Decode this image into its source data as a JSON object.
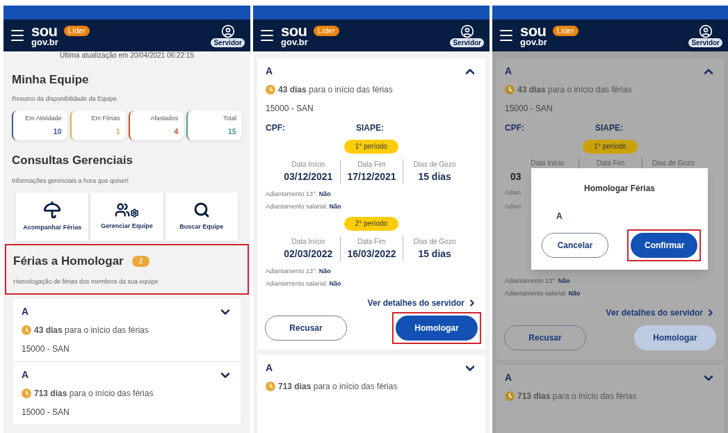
{
  "screens": [
    {
      "kind": "home",
      "header": {
        "logo_top": "sou",
        "logo_bottom": "gov.br",
        "role": "Líder",
        "profile": "Servidor"
      },
      "last_update": "Última atualização em 20/04/2021 06:22:15",
      "team": {
        "title": "Minha Equipe",
        "subtitle": "Resumo da disponibilidade da Equipe",
        "stats": [
          {
            "label": "Em Atividade",
            "value": "10",
            "color": "#3b5b9e"
          },
          {
            "label": "Em Férias",
            "value": "1",
            "color": "#e3b341"
          },
          {
            "label": "Afastados",
            "value": "4",
            "color": "#c4552b"
          },
          {
            "label": "Total",
            "value": "15",
            "color": "#4d9c8c"
          }
        ]
      },
      "queries": {
        "title": "Consultas Gerenciais",
        "subtitle": "Informações gerenciais a hora que quiser!",
        "shortcuts": [
          {
            "label": "Acompanhar Férias",
            "kind": "beach"
          },
          {
            "label": "Gerenciar Equipe",
            "kind": "team"
          },
          {
            "label": "Buscar Equipe",
            "kind": "search"
          }
        ]
      },
      "pending": {
        "title": "Férias a Homologar",
        "count": "2",
        "subtitle": "Homologação de férias dos membros da sua equipe",
        "highlighted": true
      },
      "requests": [
        {
          "name": "A",
          "expanded": false,
          "countdown": "**43 dias** para o início das férias",
          "unit": "15000 - SAN"
        },
        {
          "name": "A",
          "expanded": false,
          "countdown": "**713 dias** para o início das férias",
          "unit": "15000 - SAN"
        }
      ]
    },
    {
      "kind": "detail",
      "header": {
        "logo_top": "sou",
        "logo_bottom": "gov.br",
        "role": "Líder",
        "profile": "Servidor"
      },
      "request": {
        "name": "A",
        "expanded": true,
        "countdown": "**43 dias** para o início das férias",
        "unit": "15000 - SAN",
        "cpf_label": "CPF:",
        "siape_label": "SIAPE:",
        "periods": [
          {
            "label": "1° período",
            "fields": [
              {
                "label": "Data Início",
                "value": "03/12/2021"
              },
              {
                "label": "Data Fim",
                "value": "17/12/2021"
              },
              {
                "label": "Dias de Gozo",
                "value": "15 dias"
              }
            ],
            "advances": [
              "Adiantamento 13°: **Não**",
              "Adiantamento salarial: **Não**"
            ]
          },
          {
            "label": "2° período",
            "fields": [
              {
                "label": "Data Início",
                "value": "02/03/2022"
              },
              {
                "label": "Data Fim",
                "value": "16/03/2022"
              },
              {
                "label": "Dias de Gozo",
                "value": "15 dias"
              }
            ],
            "advances": [
              "Adiantamento 13°: **Não**",
              "Adiantamento salarial: **Não**"
            ]
          }
        ],
        "details_link": "Ver detalhes do servidor",
        "buttons": [
          {
            "label": "Recusar",
            "kind": "outline",
            "highlighted": false,
            "disabled": false
          },
          {
            "label": "Homologar",
            "kind": "primary",
            "highlighted": true,
            "disabled": false
          }
        ]
      },
      "next_request": {
        "name": "A",
        "expanded": false,
        "countdown": "**713 dias** para o início das férias"
      }
    },
    {
      "kind": "confirm",
      "header": {
        "logo_top": "sou",
        "logo_bottom": "gov.br",
        "role": "Líder",
        "profile": "Servidor"
      },
      "request": {
        "name": "A",
        "expanded": true,
        "countdown": "**43 dias** para o início das férias",
        "unit": "15000 - SAN",
        "cpf_label": "CPF:",
        "siape_label": "SIAPE:",
        "period_label": "1° período",
        "field_labels": [
          "Data Início",
          "Data Fim",
          "Dias de Gozo"
        ],
        "fragments": [
          "03",
          "Adian",
          "Adian"
        ],
        "advances": [
          "Adiantamento 13°: **Não**",
          "Adiantamento salarial: **Não**"
        ],
        "details_link": "Ver detalhes do servidor",
        "buttons": [
          {
            "label": "Recusar",
            "kind": "outline",
            "highlighted": false,
            "disabled": false
          },
          {
            "label": "Homologar",
            "kind": "primary",
            "highlighted": false,
            "disabled": true
          }
        ]
      },
      "dialog": {
        "title": "Homologar Férias",
        "name": "A",
        "buttons": [
          {
            "label": "Cancelar",
            "kind": "outline",
            "highlighted": false,
            "disabled": false
          },
          {
            "label": "Confirmar",
            "kind": "primary",
            "highlighted": true,
            "disabled": false
          }
        ]
      },
      "next_request": {
        "name": "A",
        "expanded": false,
        "countdown": "**713 dias** para o início das férias"
      }
    }
  ]
}
